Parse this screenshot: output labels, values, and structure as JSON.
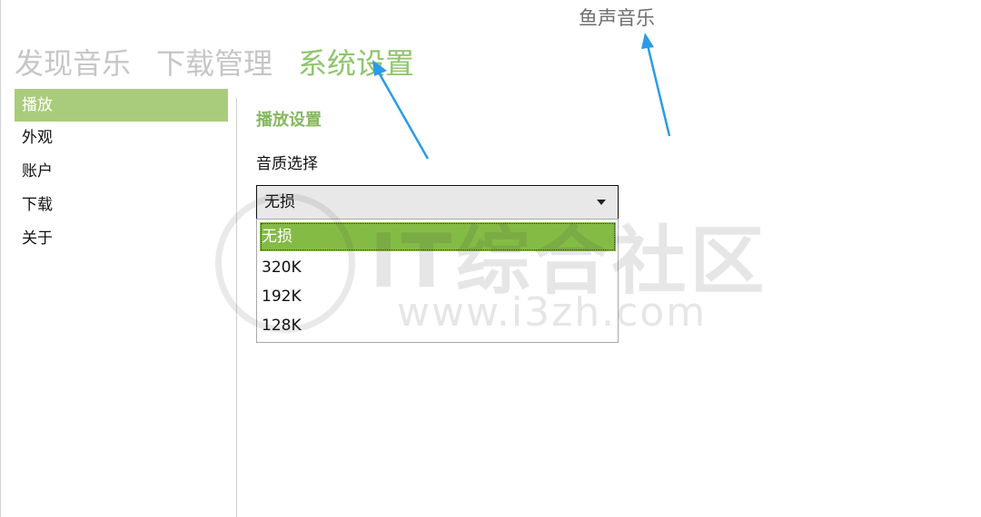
{
  "app": {
    "title": "鱼声音乐"
  },
  "nav": {
    "tabs": [
      {
        "label": "发现音乐",
        "active": false
      },
      {
        "label": "下载管理",
        "active": false
      },
      {
        "label": "系统设置",
        "active": true
      }
    ]
  },
  "sidebar": {
    "items": [
      {
        "label": "播放",
        "active": true
      },
      {
        "label": "外观",
        "active": false
      },
      {
        "label": "账户",
        "active": false
      },
      {
        "label": "下载",
        "active": false
      },
      {
        "label": "关于",
        "active": false
      }
    ]
  },
  "settings": {
    "section_title": "播放设置",
    "quality": {
      "label": "音质选择",
      "selected": "无损",
      "options": [
        "无损",
        "320K",
        "192K",
        "128K"
      ]
    }
  },
  "watermark": {
    "text": "IT综合社区",
    "url": "www.i3zh.com"
  },
  "colors": {
    "accent": "#8ec56b",
    "sidebar_active_bg": "#a9cc7c",
    "option_selected_bg": "#84bb45",
    "annotation_arrow": "#2a9be8"
  }
}
